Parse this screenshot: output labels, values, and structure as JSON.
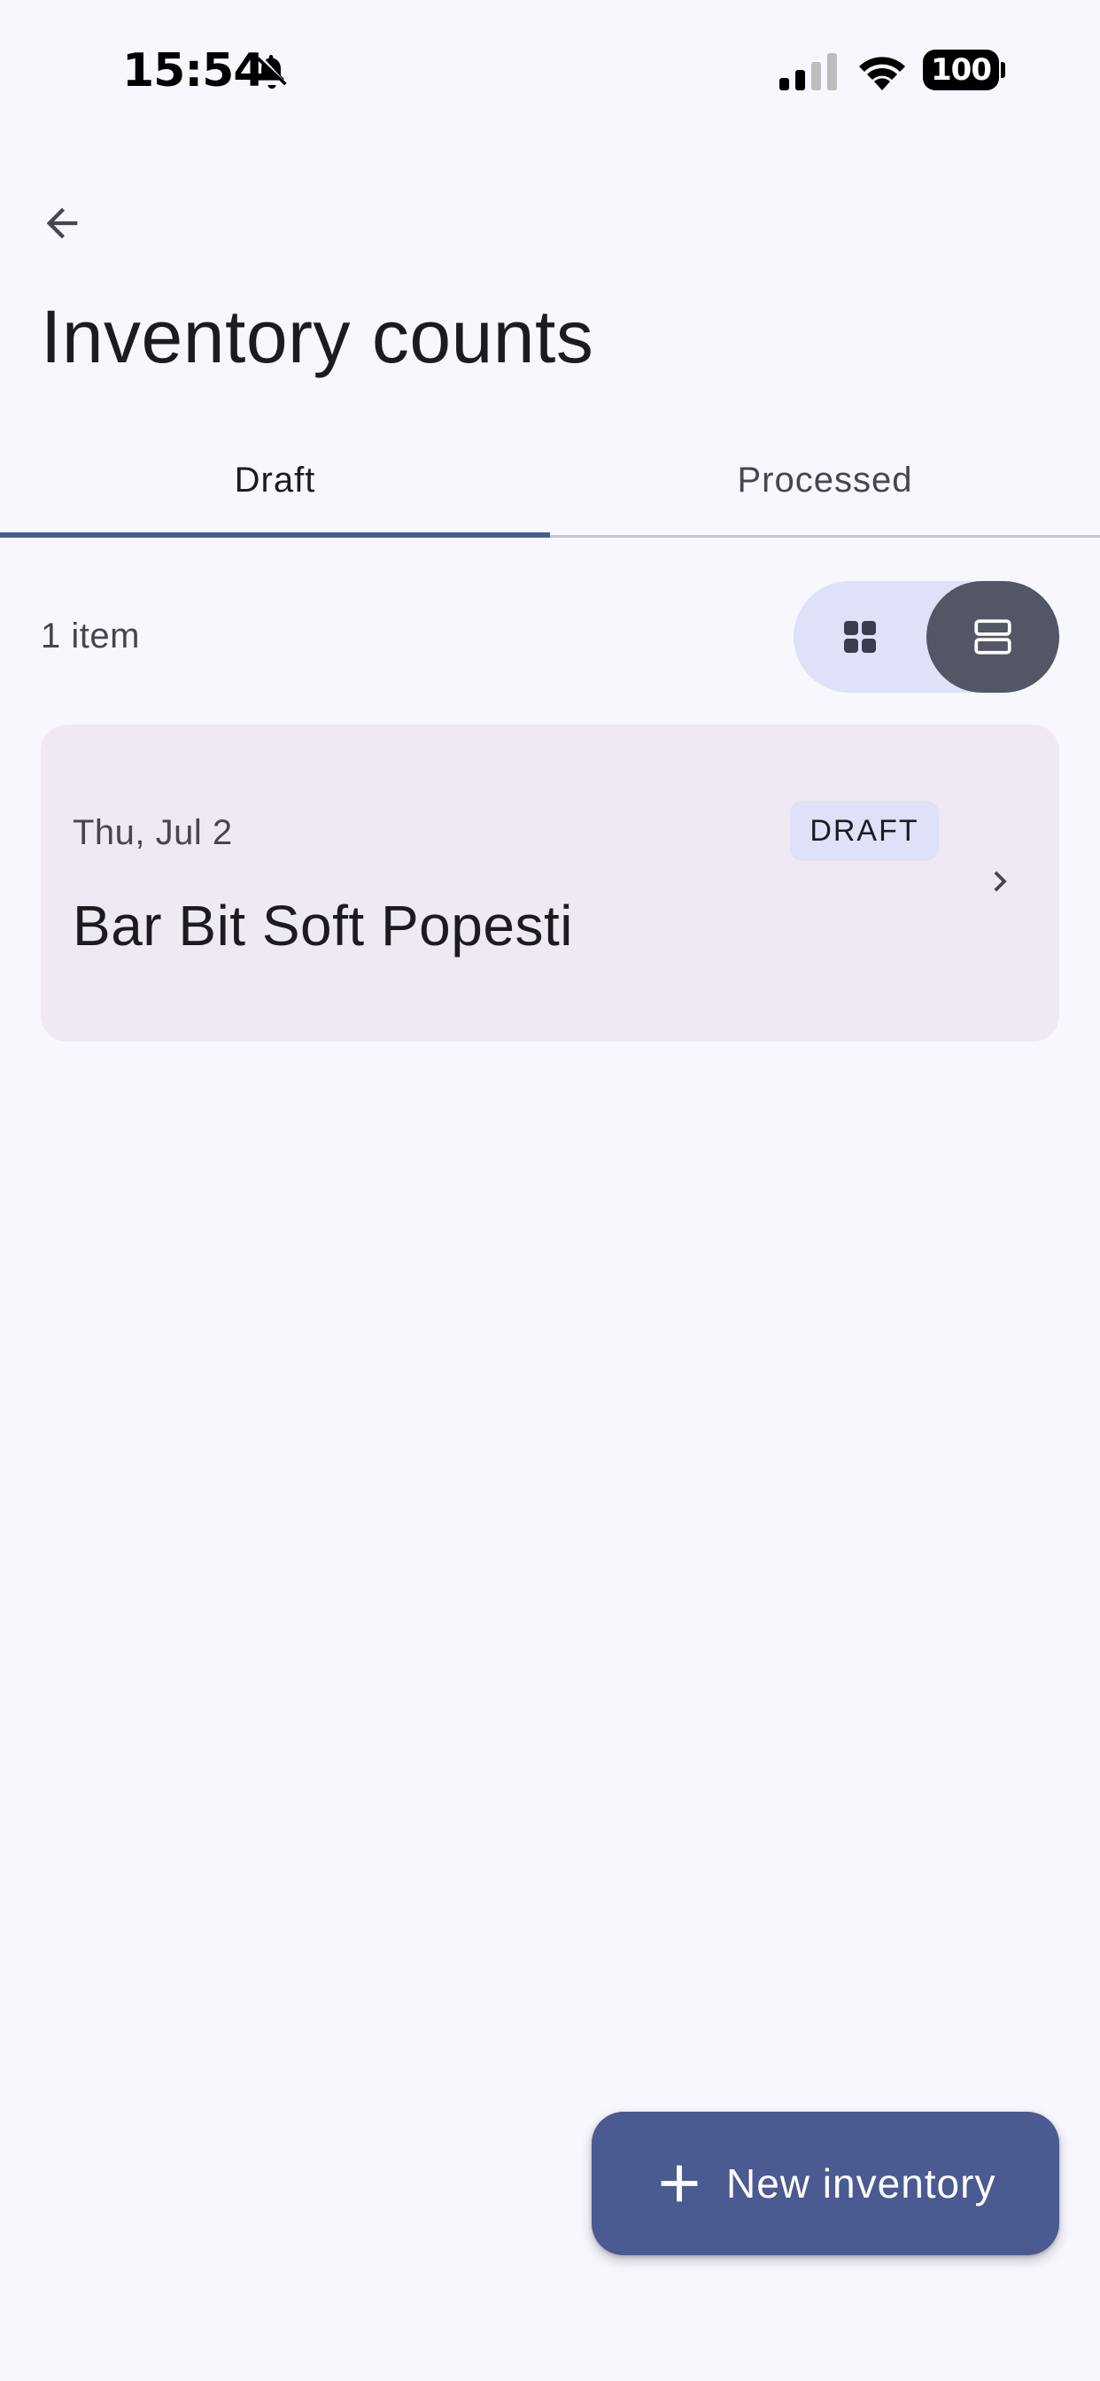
{
  "status_bar": {
    "time": "15:54",
    "battery": "100",
    "icons": [
      "bell-off-icon",
      "cellular-signal-icon",
      "wifi-icon",
      "battery-icon"
    ]
  },
  "app_bar": {
    "back_icon": "arrow-left-icon",
    "title": "Inventory counts"
  },
  "tabs": [
    {
      "label": "Draft",
      "selected": true
    },
    {
      "label": "Processed",
      "selected": false
    }
  ],
  "toolbar": {
    "item_count": "1 item",
    "view_toggle": {
      "options": [
        "grid-view-icon",
        "list-view-icon"
      ],
      "selected": "list-view-icon"
    }
  },
  "inventories": [
    {
      "date": "Thu, Jul 2",
      "name": "Bar Bit Soft Popesti",
      "status": "DRAFT",
      "chevron_icon": "chevron-right-icon"
    }
  ],
  "fab": {
    "icon": "plus-icon",
    "label": "New inventory"
  },
  "colors": {
    "background": "#f8f7fd",
    "primary": "#4b5a90",
    "card_background": "#efe9f4",
    "badge_background": "#dfe1f9",
    "toggle_selected": "#535665"
  }
}
